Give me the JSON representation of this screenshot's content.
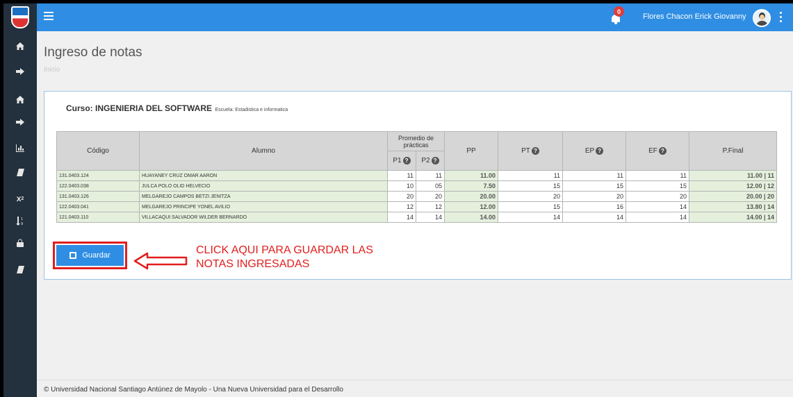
{
  "header": {
    "notification_count": "0",
    "user_name": "Flores Chacon Erick Giovanny"
  },
  "page": {
    "title": "Ingreso de notas",
    "breadcrumb": "Inicio"
  },
  "course": {
    "title": "Curso: INGENIERIA DEL SOFTWARE",
    "school": "Escuela: Estadistica e informatica"
  },
  "table": {
    "headers": {
      "codigo": "Código",
      "alumno": "Alumno",
      "promedio": "Promedio de prácticas",
      "p1": "P1",
      "p2": "P2",
      "pp": "PP",
      "pt": "PT",
      "ep": "EP",
      "ef": "EF",
      "pfinal": "P.Final"
    },
    "rows": [
      {
        "codigo": "131.0403.124",
        "alumno": "HUAYANEY CRUZ OMAR AARON",
        "p1": "11",
        "p2": "11",
        "pp": "11.00",
        "pt": "11",
        "ep": "11",
        "ef": "11",
        "pfinal": "11.00 | 11"
      },
      {
        "codigo": "122.0403.038",
        "alumno": "JULCA POLO OLID HELVECIO",
        "p1": "10",
        "p2": "05",
        "pp": "7.50",
        "pt": "15",
        "ep": "15",
        "ef": "15",
        "pfinal": "12.00 | 12"
      },
      {
        "codigo": "131.0403.126",
        "alumno": "MELGAREJO CAMPOS BETZI JENITZA",
        "p1": "20",
        "p2": "20",
        "pp": "20.00",
        "pt": "20",
        "ep": "20",
        "ef": "20",
        "pfinal": "20.00 | 20"
      },
      {
        "codigo": "122.0403.041",
        "alumno": "MELGAREJO PRINCIPE YONEL AVILIO",
        "p1": "12",
        "p2": "12",
        "pp": "12.00",
        "pt": "15",
        "ep": "16",
        "ef": "14",
        "pfinal": "13.80 | 14"
      },
      {
        "codigo": "121.0403.110",
        "alumno": "VILLACAQUI SALVADOR WILDER BERNARDO",
        "p1": "14",
        "p2": "14",
        "pp": "14.00",
        "pt": "14",
        "ep": "14",
        "ef": "14",
        "pfinal": "14.00 | 14"
      }
    ]
  },
  "actions": {
    "save_label": "Guardar"
  },
  "annotation": {
    "line1": "CLICK AQUI PARA GUARDAR LAS",
    "line2": "NOTAS INGRESADAS",
    "color": "#e21d1d"
  },
  "footer": {
    "text": "© Universidad Nacional Santiago Antúnez de Mayolo - Una Nueva Universidad para el Desarrollo"
  },
  "colors": {
    "topbar": "#2f8ee3",
    "sidebar": "#23303d",
    "row_green": "#e4f0dc"
  },
  "icons": {
    "sidebar": [
      "home-icon",
      "sign-out-icon",
      "home-icon",
      "sign-out-icon",
      "bar-chart-icon",
      "book-icon",
      "subscript-icon",
      "sort-numeric-icon",
      "lock-icon",
      "book-icon"
    ]
  }
}
